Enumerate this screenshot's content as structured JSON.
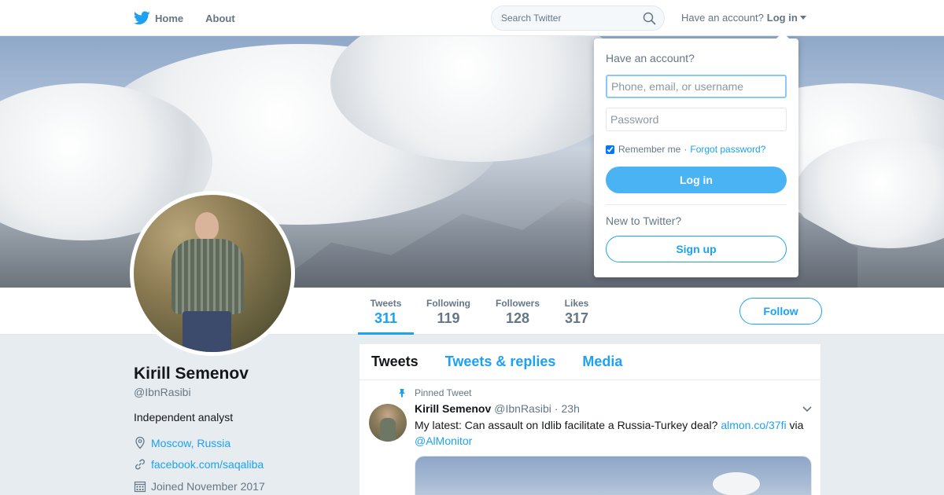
{
  "nav": {
    "home_label": "Home",
    "about_label": "About",
    "search_placeholder": "Search Twitter",
    "have_account": "Have an account?",
    "login_label": "Log in"
  },
  "profile": {
    "name": "Kirill Semenov",
    "handle": "@IbnRasibi",
    "bio": "Independent analyst",
    "location": "Moscow, Russia",
    "website": "facebook.com/saqaliba",
    "joined": "Joined November 2017"
  },
  "stats": [
    {
      "label": "Tweets",
      "value": "311"
    },
    {
      "label": "Following",
      "value": "119"
    },
    {
      "label": "Followers",
      "value": "128"
    },
    {
      "label": "Likes",
      "value": "317"
    }
  ],
  "follow_label": "Follow",
  "tabs": [
    {
      "label": "Tweets"
    },
    {
      "label": "Tweets & replies"
    },
    {
      "label": "Media"
    }
  ],
  "tweet": {
    "pinned_label": "Pinned Tweet",
    "author_name": "Kirill Semenov",
    "author_handle": "@IbnRasibi",
    "separator": "·",
    "time": "23h",
    "text_before": "My latest: Can assault on Idlib facilitate a Russia-Turkey deal? ",
    "link": "almon.co/37fi",
    "text_mid": " via ",
    "mention": "@AlMonitor"
  },
  "login_dropdown": {
    "title": "Have an account?",
    "username_placeholder": "Phone, email, or username",
    "password_placeholder": "Password",
    "remember_label": "Remember me",
    "separator": "·",
    "forgot_label": "Forgot password?",
    "login_button": "Log in",
    "new_label": "New to Twitter?",
    "signup_button": "Sign up"
  },
  "colors": {
    "accent": "#1da1f2",
    "background": "#e6ecf0"
  }
}
